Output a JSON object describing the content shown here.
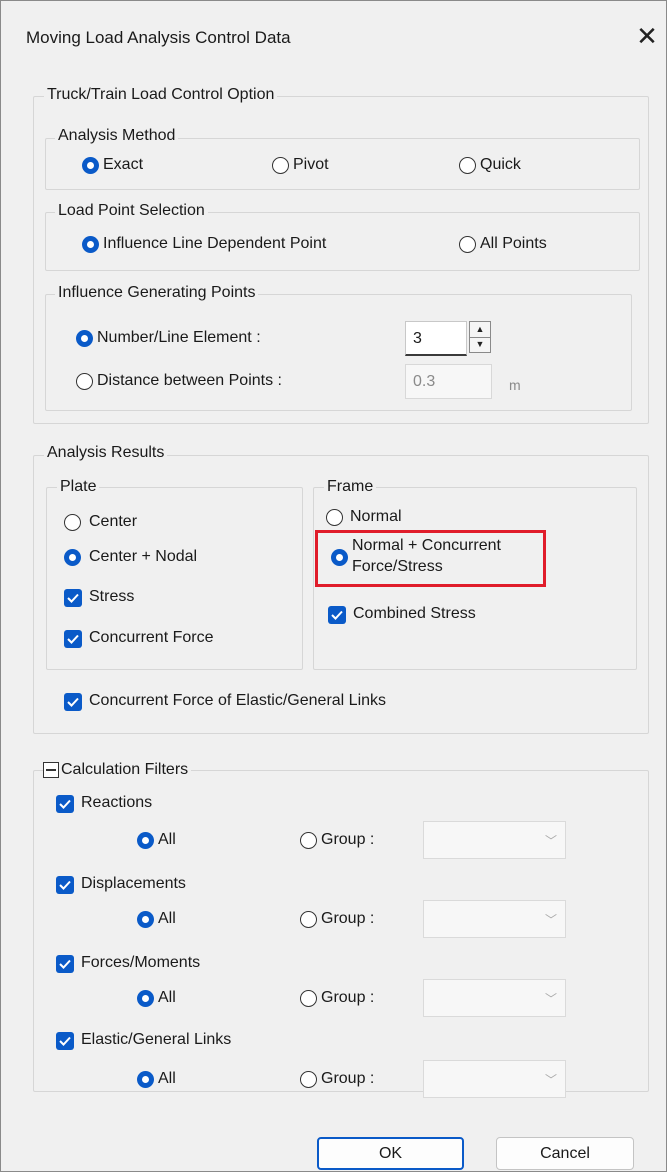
{
  "window": {
    "title": "Moving Load Analysis Control Data",
    "close_glyph": "✕"
  },
  "truck": {
    "legend": "Truck/Train Load Control Option",
    "analysis_method": {
      "legend": "Analysis Method",
      "options": [
        "Exact",
        "Pivot",
        "Quick"
      ],
      "selected": "Exact"
    },
    "load_point": {
      "legend": "Load Point Selection",
      "options": [
        "Influence Line Dependent Point",
        "All Points"
      ],
      "selected": "Influence Line Dependent Point"
    },
    "influence": {
      "legend": "Influence Generating Points",
      "number_label": "Number/Line Element :",
      "number_value": "3",
      "distance_label": "Distance between Points :",
      "distance_value": "0.3",
      "distance_unit": "m",
      "selected": "Number/Line Element :"
    }
  },
  "results": {
    "legend": "Analysis Results",
    "plate": {
      "legend": "Plate",
      "center": "Center",
      "center_nodal": "Center + Nodal",
      "stress": "Stress",
      "concurrent": "Concurrent Force",
      "selected": "Center + Nodal"
    },
    "frame": {
      "legend": "Frame",
      "normal": "Normal",
      "normal_concurrent_1": "Normal + Concurrent",
      "normal_concurrent_2": "Force/Stress",
      "combined": "Combined Stress",
      "selected": "Normal + Concurrent Force/Stress"
    },
    "links": "Concurrent Force of Elastic/General Links"
  },
  "filters": {
    "legend": "Calculation Filters",
    "all_label": "All",
    "group_label": "Group :",
    "items": [
      {
        "label": "Reactions",
        "checked": true,
        "selected": "All"
      },
      {
        "label": "Displacements",
        "checked": true,
        "selected": "All"
      },
      {
        "label": "Forces/Moments",
        "checked": true,
        "selected": "All"
      },
      {
        "label": "Elastic/General Links",
        "checked": true,
        "selected": "All"
      }
    ]
  },
  "buttons": {
    "ok": "OK",
    "cancel": "Cancel"
  },
  "colors": {
    "accent": "#0a5ac8",
    "highlight": "#e01c2a"
  }
}
